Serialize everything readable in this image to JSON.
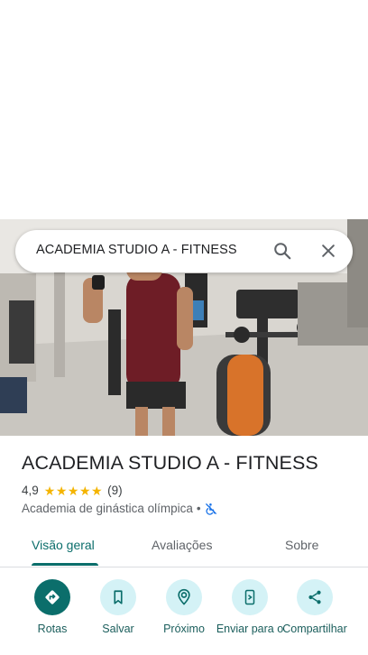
{
  "search": {
    "query": "ACADEMIA STUDIO A - FITNESS"
  },
  "place": {
    "name": "ACADEMIA STUDIO A - FITNESS",
    "rating": "4,9",
    "stars": 5,
    "reviews": "(9)",
    "category": "Academia de ginástica olímpica",
    "separator": "•"
  },
  "tabs": [
    {
      "label": "Visão geral",
      "active": true
    },
    {
      "label": "Avaliações",
      "active": false
    },
    {
      "label": "Sobre",
      "active": false
    }
  ],
  "actions": [
    {
      "label": "Rotas",
      "icon": "directions-icon"
    },
    {
      "label": "Salvar",
      "icon": "bookmark-icon"
    },
    {
      "label": "Próximo",
      "icon": "nearby-icon"
    },
    {
      "label": "Enviar para o",
      "icon": "send-to-phone-icon"
    },
    {
      "label": "Compartilhar",
      "icon": "share-icon"
    }
  ],
  "colors": {
    "accent": "#0b6e6b",
    "action_bg": "#d4f2f6",
    "star": "#f4b400"
  }
}
